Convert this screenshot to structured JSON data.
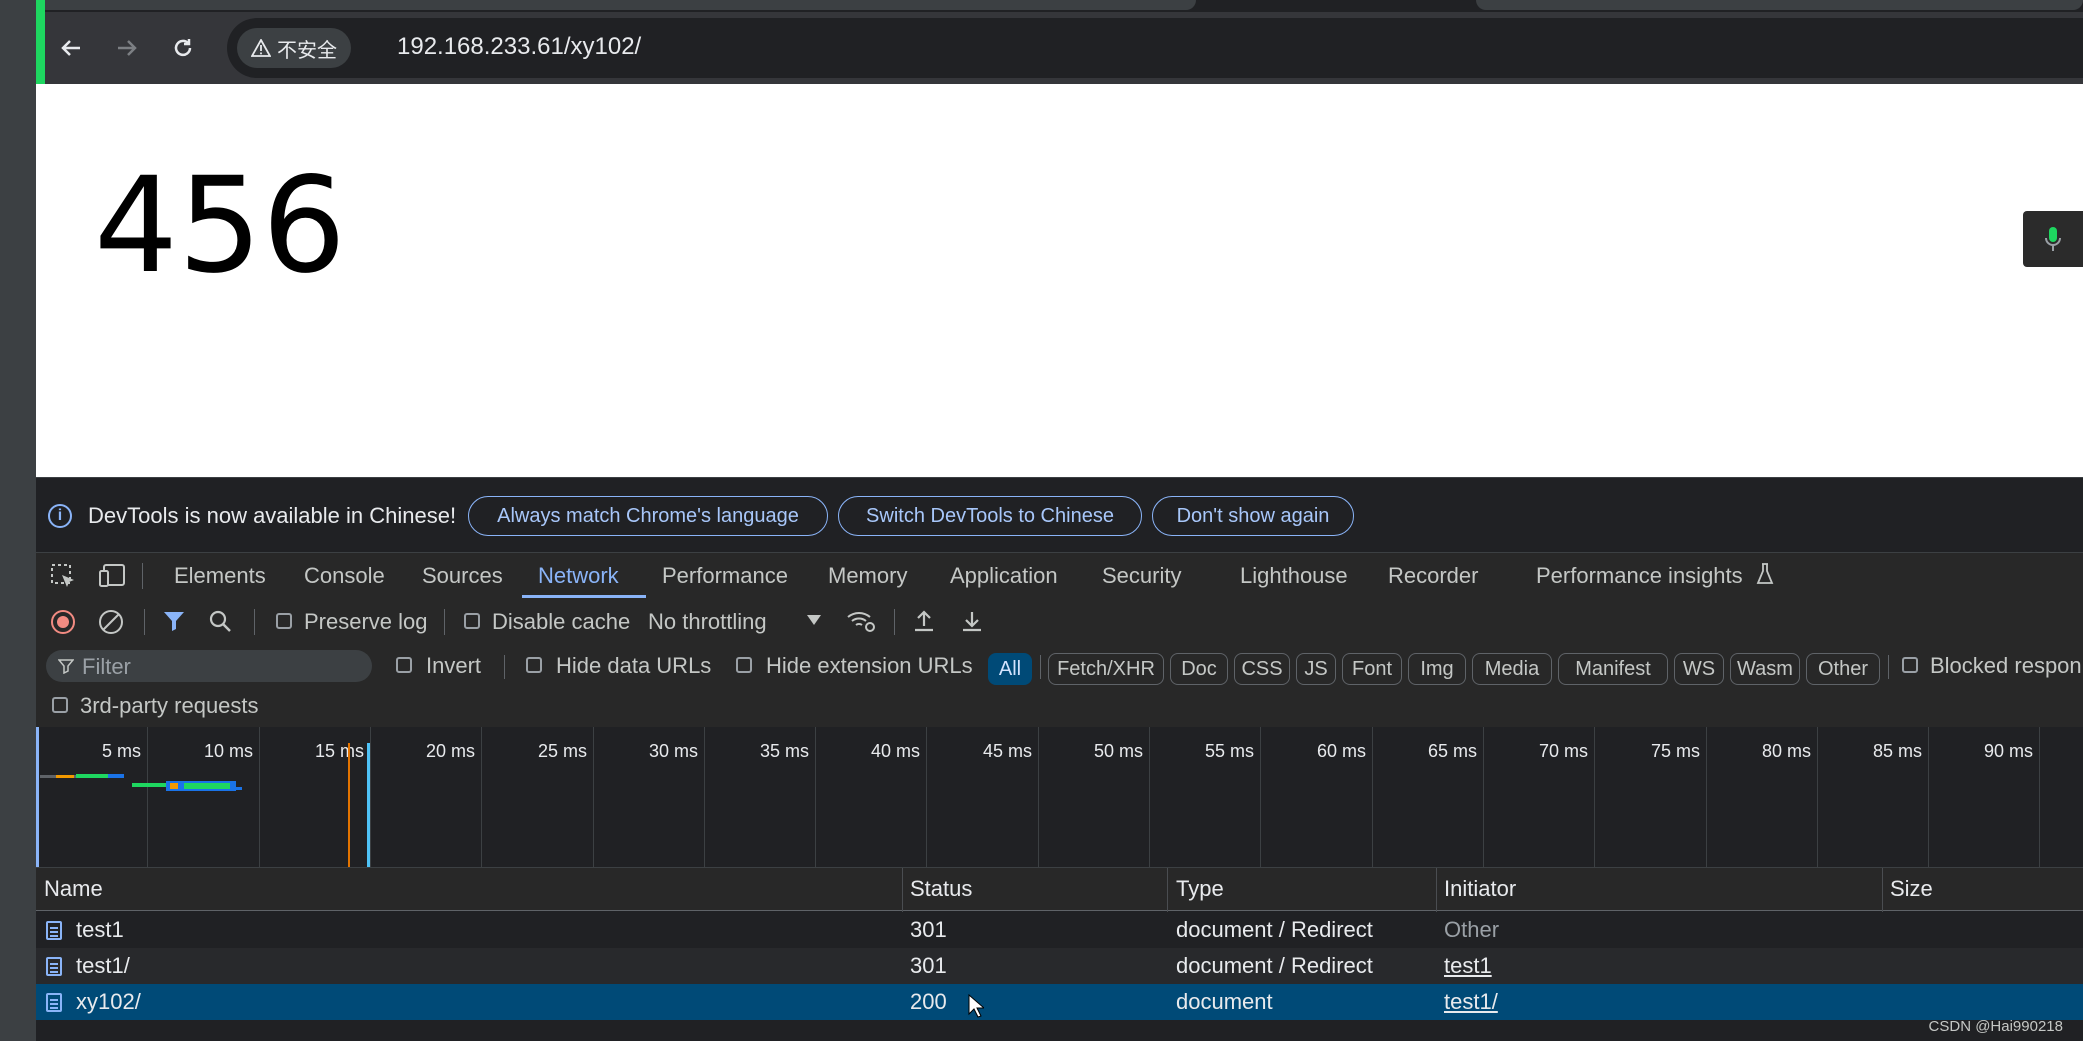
{
  "browser": {
    "insecure_label": "不安全",
    "url": "192.168.233.61/xy102/"
  },
  "page": {
    "content": "456"
  },
  "infobar": {
    "message": "DevTools is now available in Chinese!",
    "btn_match": "Always match Chrome's language",
    "btn_switch": "Switch DevTools to Chinese",
    "btn_dont": "Don't show again"
  },
  "panels": [
    "Elements",
    "Console",
    "Sources",
    "Network",
    "Performance",
    "Memory",
    "Application",
    "Security",
    "Lighthouse",
    "Recorder",
    "Performance insights"
  ],
  "active_panel": "Network",
  "network_toolbar": {
    "preserve_log": "Preserve log",
    "disable_cache": "Disable cache",
    "throttling": "No throttling"
  },
  "filter": {
    "placeholder": "Filter",
    "invert": "Invert",
    "hide_data_urls": "Hide data URLs",
    "hide_extension_urls": "Hide extension URLs",
    "types": [
      "All",
      "Fetch/XHR",
      "Doc",
      "CSS",
      "JS",
      "Font",
      "Img",
      "Media",
      "Manifest",
      "WS",
      "Wasm",
      "Other"
    ],
    "active_type": "All",
    "blocked": "Blocked respon",
    "third_party": "3rd-party requests"
  },
  "timeline": {
    "ticks": [
      "5 ms",
      "10 ms",
      "15 ms",
      "20 ms",
      "25 ms",
      "30 ms",
      "35 ms",
      "40 ms",
      "45 ms",
      "50 ms",
      "55 ms",
      "60 ms",
      "65 ms",
      "70 ms",
      "75 ms",
      "80 ms",
      "85 ms",
      "90 ms"
    ]
  },
  "table": {
    "headers": {
      "name": "Name",
      "status": "Status",
      "type": "Type",
      "initiator": "Initiator",
      "size": "Size"
    },
    "rows": [
      {
        "name": "test1",
        "status": "301",
        "type": "document / Redirect",
        "initiator": "Other"
      },
      {
        "name": "test1/",
        "status": "301",
        "type": "document / Redirect",
        "initiator": "test1"
      },
      {
        "name": "xy102/",
        "status": "200",
        "type": "document",
        "initiator": "test1/"
      }
    ]
  },
  "watermark": "CSDN @Hai990218",
  "colors": {
    "accent": "#8ab4f8",
    "selected_row": "#004a77",
    "record_red": "#f28b82"
  }
}
